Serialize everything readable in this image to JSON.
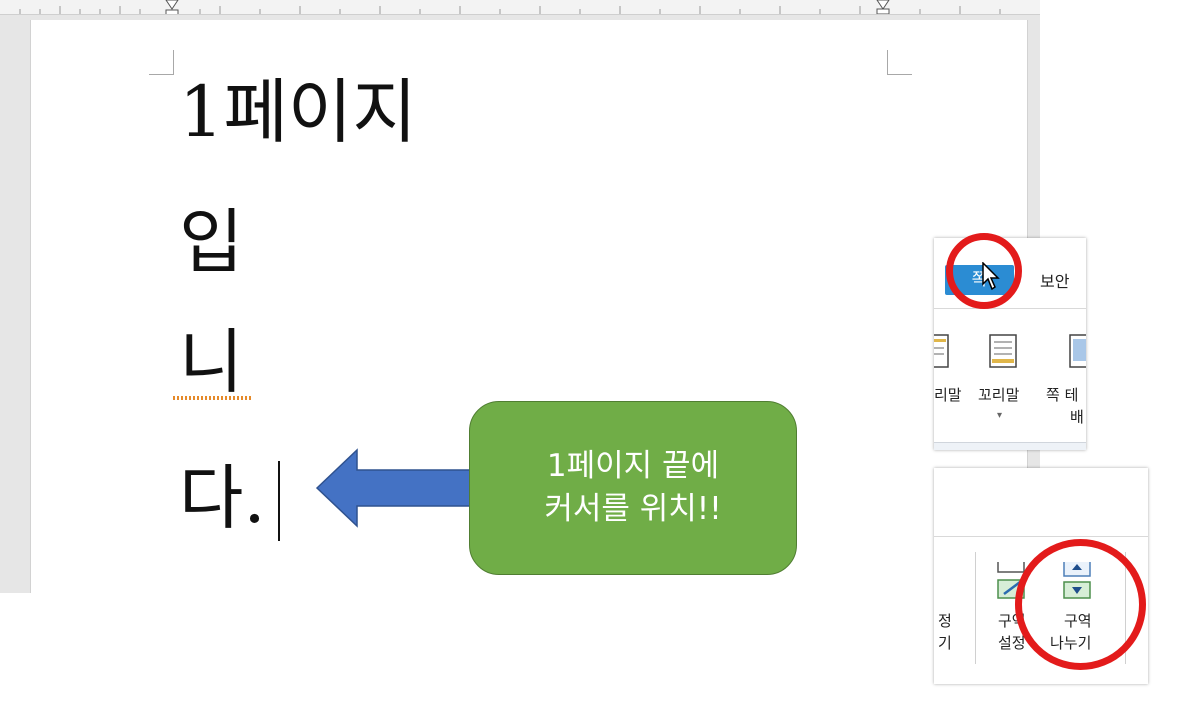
{
  "document": {
    "lines": [
      "1페이지",
      "입",
      "니",
      "다."
    ]
  },
  "callout": {
    "line1": "1페이지 끝에",
    "line2": "커서를 위치!!"
  },
  "inset_tabs": {
    "active_tab": "쪽",
    "next_tab": "보안",
    "buttons": {
      "header_partial": "리말",
      "footer": "꼬리말",
      "page_theme_line1": "쪽 테",
      "page_theme_line2": "배"
    }
  },
  "inset_section": {
    "partial_line1": "정",
    "partial_line2": "기",
    "section_settings_line1": "구역",
    "section_settings_line2": "설정",
    "section_break_line1": "구역",
    "section_break_line2": "나누기"
  },
  "colors": {
    "callout_fill": "#70ad47",
    "arrow_fill": "#4472c4",
    "highlight_ring": "#e31b1b",
    "active_tab": "#2b8cd3"
  }
}
